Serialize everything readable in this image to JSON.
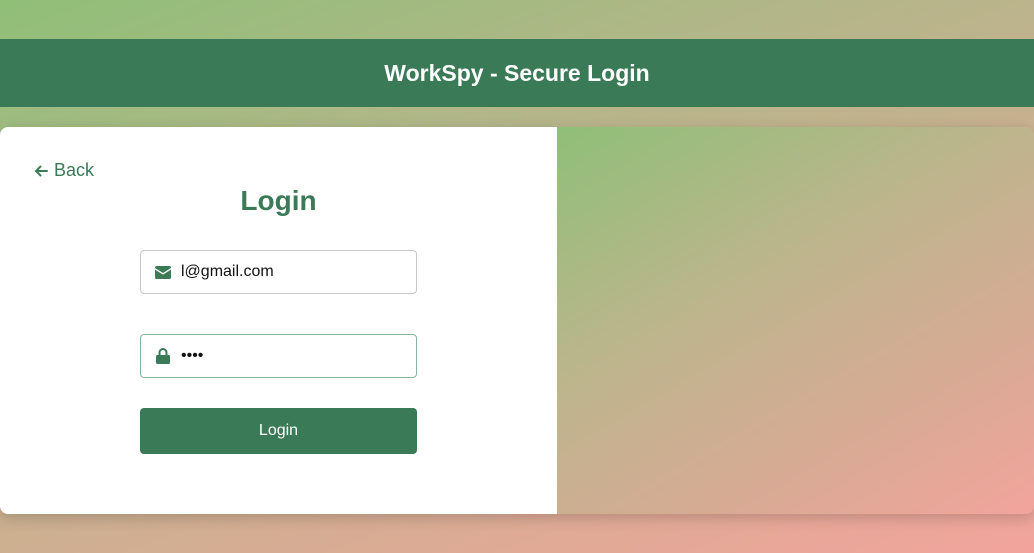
{
  "header": {
    "title": "WorkSpy - Secure Login"
  },
  "login_form": {
    "back_label": "Back",
    "title": "Login",
    "email": {
      "value": "l@gmail.com",
      "icon": "envelope-icon"
    },
    "password": {
      "value": "••••",
      "icon": "lock-icon"
    },
    "submit_label": "Login"
  },
  "colors": {
    "primary": "#3a7a57",
    "card_background": "#ffffff",
    "gradient_start": "#8fbf78",
    "gradient_end": "#f2a49c"
  }
}
